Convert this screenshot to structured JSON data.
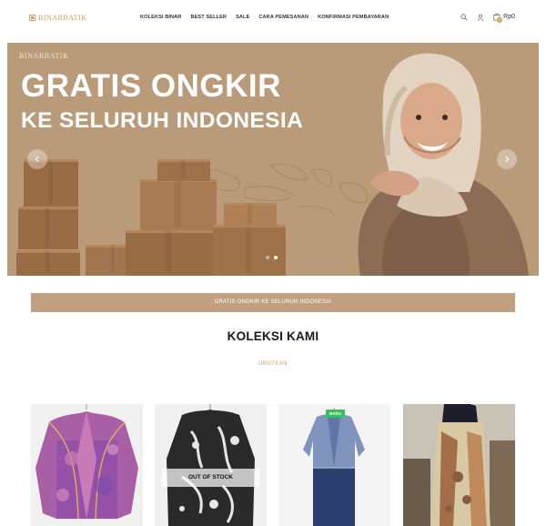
{
  "header": {
    "logo": "BINARBATIK",
    "nav": [
      "KOLEKSI BINAR",
      "BEST SELLER",
      "SALE",
      "CARA PEMESANAN",
      "KONFIRMASI PEMBAYARAN"
    ],
    "cart_count": "0",
    "cart_price": "Rp0",
    "icons": [
      "search-icon",
      "user-icon",
      "cart-icon"
    ]
  },
  "hero": {
    "brand": "BINARBATIK",
    "title_line1": "GRATIS ONGKIR",
    "title_line2": "KE SELURUH INDONESIA",
    "slide_count": 2,
    "active_slide": 2
  },
  "strip": {
    "text": "GRATIS ONGKIR KE SELURUH INDONESIA"
  },
  "section": {
    "title": "KOLEKSI KAMI",
    "sort_label": "URUTKAN"
  },
  "products": [
    {
      "badge": "",
      "status": ""
    },
    {
      "badge": "",
      "status": "OUT OF STOCK"
    },
    {
      "badge": "BARU",
      "status": ""
    },
    {
      "badge": "",
      "status": ""
    }
  ],
  "colors": {
    "accent": "#c9a15b",
    "hero_bg": "#b99a79",
    "strip_bg": "#c1a081",
    "new_badge": "#35c25a"
  }
}
